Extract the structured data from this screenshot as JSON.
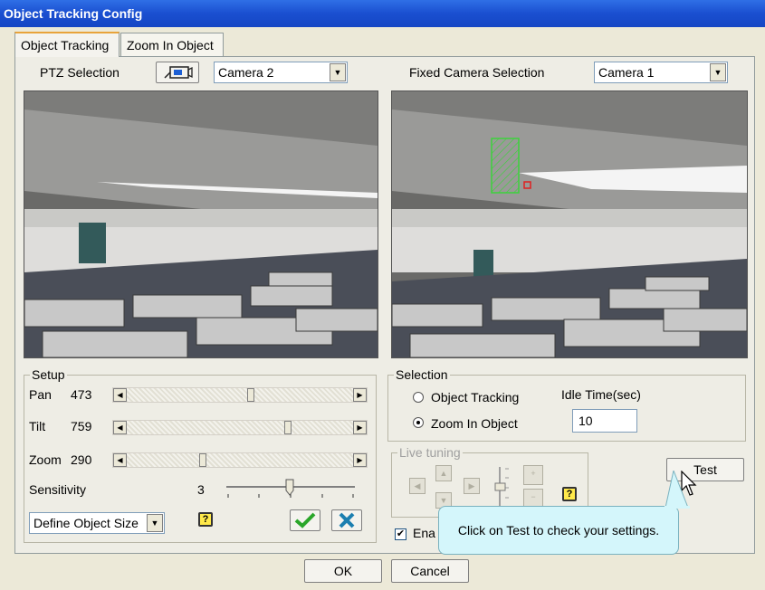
{
  "window": {
    "title": "Object Tracking Config"
  },
  "tabs": [
    {
      "label": "Object Tracking",
      "active": true
    },
    {
      "label": "Zoom In Object",
      "active": false
    }
  ],
  "ptz": {
    "label": "PTZ Selection",
    "camera": "Camera 2",
    "icon": "ptz-camera-icon"
  },
  "fixed": {
    "label": "Fixed Camera Selection",
    "camera": "Camera 1"
  },
  "setup": {
    "title": "Setup",
    "pan": {
      "label": "Pan",
      "value": "473",
      "level": 0.55
    },
    "tilt": {
      "label": "Tilt",
      "value": "759",
      "level": 0.72
    },
    "zoom": {
      "label": "Zoom",
      "value": "290",
      "level": 0.33
    },
    "sensitivity": {
      "label": "Sensitivity",
      "value": "3"
    },
    "object_size": "Define Object Size"
  },
  "selection": {
    "title": "Selection",
    "option_tracking": "Object Tracking",
    "option_zoom": "Zoom In Object",
    "selected": "Zoom In Object",
    "idle_label": "Idle Time(sec)",
    "idle_value": "10"
  },
  "live_tuning": {
    "title": "Live tuning"
  },
  "test_label": "Test",
  "enable_label": "Ena",
  "tooltip": "Click on Test to check your settings.",
  "ok_label": "OK",
  "cancel_label": "Cancel",
  "colors": {
    "title_bar": "#1a4fd0",
    "tab_accent": "#e8a33a",
    "selection_box": "#3cd23c",
    "tooltip_bg": "#d4f6fb"
  }
}
